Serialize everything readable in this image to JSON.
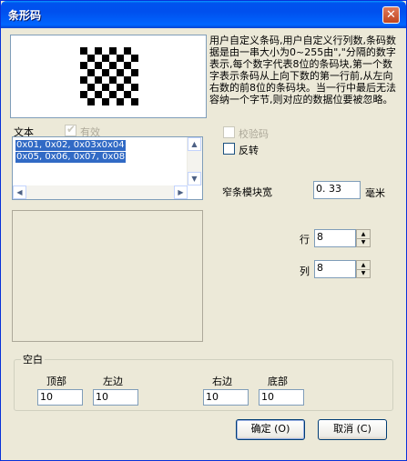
{
  "window": {
    "title": "条形码",
    "close_glyph": "✕"
  },
  "description": "用户自定义条码,用户自定义行列数,条码数据是由一串大小为0~255由\",\"分隔的数字表示,每个数字代表8位的条码块,第一个数字表示条码从上向下数的第一行前,从左向右数的前8位的条码块。当一行中最后无法容纳一个字节,则对应的数据位要被忽略。",
  "text_section": {
    "label": "文本",
    "valid_checkbox": {
      "label": "有效",
      "checked": true,
      "enabled": false
    },
    "lines": [
      "0x01, 0x02, 0x03x0x04",
      "0x05, 0x06, 0x07, 0x08"
    ]
  },
  "options": {
    "checksum": {
      "label": "校验码",
      "checked": false,
      "enabled": false
    },
    "reverse": {
      "label": "反转",
      "checked": false,
      "enabled": true
    }
  },
  "narrow_width": {
    "label": "窄条模块宽",
    "value": "0. 33",
    "unit": "毫米"
  },
  "rows": {
    "label": "行",
    "value": "8"
  },
  "cols": {
    "label": "列",
    "value": "8"
  },
  "margin": {
    "title": "空白",
    "top": {
      "label": "顶部",
      "value": "10"
    },
    "left": {
      "label": "左边",
      "value": "10"
    },
    "right": {
      "label": "右边",
      "value": "10"
    },
    "bottom": {
      "label": "底部",
      "value": "10"
    }
  },
  "buttons": {
    "ok": "确定 (O)",
    "cancel": "取消 (C)"
  },
  "icons": {
    "up": "up-arrow-icon",
    "down": "down-arrow-icon",
    "left": "left-arrow-icon",
    "right": "right-arrow-icon"
  }
}
